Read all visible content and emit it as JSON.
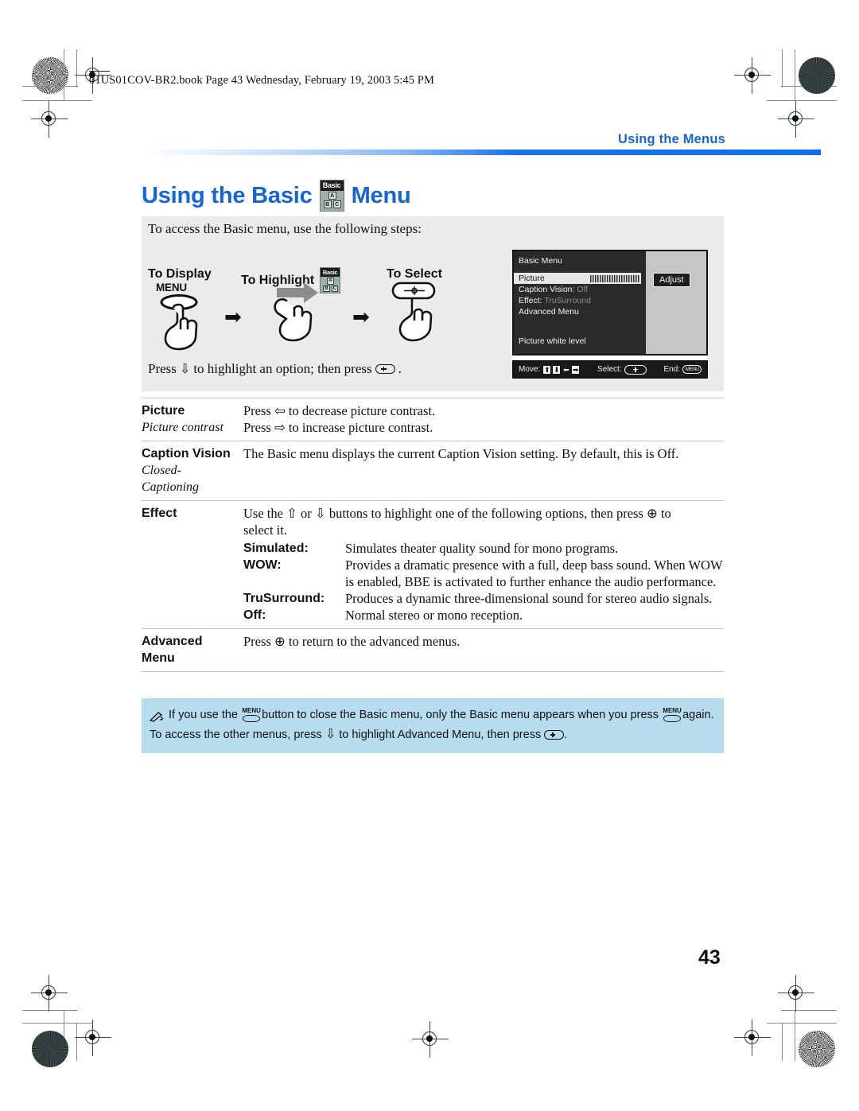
{
  "print": {
    "file_header": "01US01COV-BR2.book  Page 43  Wednesday, February 19, 2003  5:45 PM"
  },
  "header": {
    "running_head": "Using the Menus"
  },
  "title": {
    "prefix": "Using the Basic",
    "suffix": "Menu",
    "icon_name": "basic-menu-icon",
    "icon_caption": "Basic",
    "icon_blocks": [
      "A",
      "B",
      "C"
    ]
  },
  "steps": {
    "intro": "To access the Basic menu, use the following steps:",
    "label_display": "To Display",
    "label_highlight": "To Highlight",
    "label_select": "To Select",
    "menu_button_caption": "MENU",
    "arrow": "➡",
    "footer_pre": "Press",
    "footer_mid": "to highlight an option; then press",
    "footer_end": ".",
    "down_arrow_glyph": "⇩"
  },
  "osd": {
    "title": "Basic Menu",
    "items": [
      {
        "label": "Picture",
        "value": "",
        "selected": true,
        "bar": true
      },
      {
        "label": "Caption Vision:",
        "value": "Off",
        "selected": false,
        "bar": false
      },
      {
        "label": "Effect:",
        "value": "TruSurround",
        "selected": false,
        "bar": false
      },
      {
        "label": "Advanced Menu",
        "value": "",
        "selected": false,
        "bar": false
      }
    ],
    "white_level": "Picture white level",
    "adjust_label": "Adjust",
    "foot_move": "Move:",
    "foot_select": "Select:",
    "foot_end": "End:",
    "dpad_keys": [
      "⬆",
      "⬇",
      "⬅",
      "➡"
    ],
    "menu_key_label": "MENU"
  },
  "table": {
    "rows": [
      {
        "term": "Picture",
        "term_sub": "Picture contrast",
        "lines": [
          "Press ⇦ to decrease picture contrast.",
          "Press ⇨ to increase picture contrast."
        ]
      },
      {
        "term": "Caption Vision",
        "term_sub_lines": [
          "Closed-",
          "Captioning"
        ],
        "lines": [
          "The Basic menu displays the current Caption Vision setting. By default, this is Off."
        ]
      },
      {
        "term": "Effect",
        "lines": [
          "Use the ⇧ or ⇩ buttons to highlight one of the following options, then press ⊕ to",
          "select it."
        ],
        "options": [
          {
            "name": "Simulated:",
            "desc": "Simulates theater quality sound for mono programs."
          },
          {
            "name": "WOW:",
            "desc": "Provides a dramatic presence with a full, deep bass sound. When WOW is enabled, BBE is activated to further enhance the audio performance."
          },
          {
            "name": "TruSurround:",
            "desc": "Produces a dynamic three-dimensional sound for stereo audio signals."
          },
          {
            "name": "Off:",
            "desc": "Normal stereo or mono reception."
          }
        ]
      },
      {
        "term": "Advanced",
        "term_line2": "Menu",
        "lines": [
          "Press ⊕ to return to the advanced menus."
        ]
      }
    ]
  },
  "note": {
    "part1": "If you use the",
    "part2": "button to close the Basic menu, only the Basic menu appears when you press",
    "part3": "again. To access the other menus, press",
    "part4": "to highlight Advanced Menu, then press",
    "part5": ".",
    "menu_label": "MENU",
    "down_glyph": "⇩"
  },
  "page": {
    "number": "43"
  },
  "colors": {
    "accent_blue": "#1565d8",
    "note_blue": "#b7dcf0",
    "panel_gray": "#ebebeb",
    "rule_blue": "#0d6ef2"
  }
}
